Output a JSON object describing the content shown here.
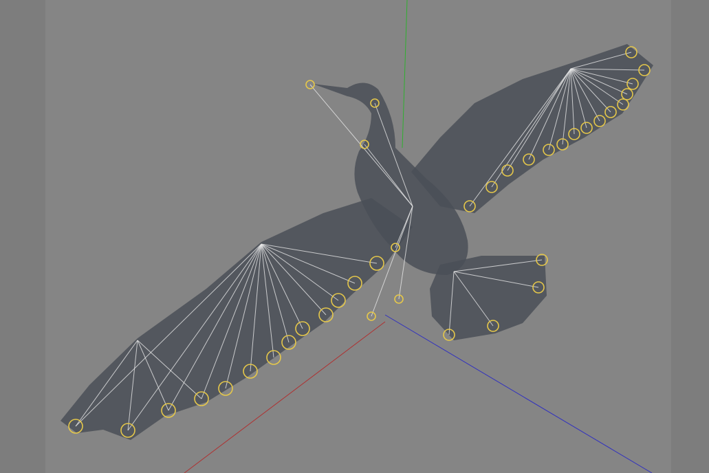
{
  "viewport": {
    "colors": {
      "background": "#858585",
      "side_band": "#7d7d7d",
      "mesh": "#4a4f57",
      "bone": "#e8e8e8",
      "joint": "#e6c84a",
      "axis_x": "#b03030",
      "axis_y": "#30b030",
      "axis_z": "#3030c0"
    }
  }
}
